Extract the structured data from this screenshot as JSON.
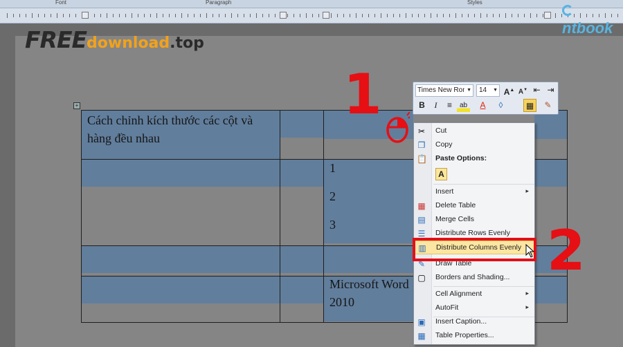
{
  "ribbon": {
    "groups": [
      "Font",
      "Paragraph",
      "Styles"
    ]
  },
  "watermark": {
    "free": "FREE",
    "download": "download",
    "top": ".top"
  },
  "brand": "ntbook",
  "table": {
    "cells": {
      "title": "Cách chỉnh kích thước các cột và hàng đều nhau",
      "numbers": [
        "1",
        "2",
        "3"
      ],
      "app": "Microsoft Word 2010"
    }
  },
  "annotations": {
    "step1": "1",
    "step2": "2"
  },
  "minitoolbar": {
    "font": "Times New Roman",
    "size": "14",
    "buttons": [
      "B",
      "I",
      "≡",
      "ab",
      "A",
      "◊",
      "▦",
      "✎"
    ]
  },
  "context_menu": {
    "items": [
      {
        "label": "Cut",
        "icon": "scissors-icon"
      },
      {
        "label": "Copy",
        "icon": "copy-icon"
      },
      {
        "label": "Paste Options:",
        "icon": "paste-icon"
      },
      {
        "label": "Insert",
        "icon": ""
      },
      {
        "label": "Delete Table",
        "icon": "delete-table-icon"
      },
      {
        "label": "Merge Cells",
        "icon": "merge-cells-icon"
      },
      {
        "label": "Distribute Rows Evenly",
        "icon": "distribute-rows-icon"
      },
      {
        "label": "Distribute Columns Evenly",
        "icon": "distribute-columns-icon"
      },
      {
        "label": "Draw Table",
        "icon": "draw-table-icon"
      },
      {
        "label": "Borders and Shading...",
        "icon": "borders-icon"
      },
      {
        "label": "Cell Alignment",
        "icon": ""
      },
      {
        "label": "AutoFit",
        "icon": ""
      },
      {
        "label": "Insert Caption...",
        "icon": "caption-icon"
      },
      {
        "label": "Table Properties...",
        "icon": "table-properties-icon"
      }
    ],
    "paste_option": "A"
  },
  "colors": {
    "selection": "#617e9c",
    "annotation": "#e60f14",
    "watermark": "#f3a21b"
  }
}
